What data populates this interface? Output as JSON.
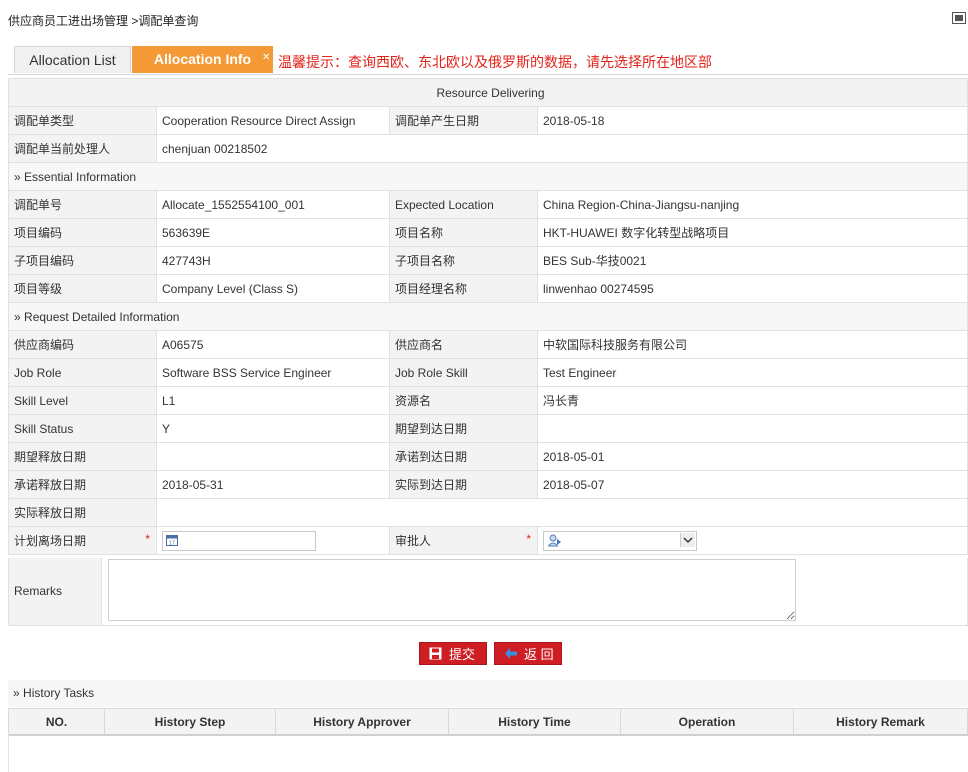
{
  "breadcrumb": "供应商员工进出场管理 >调配单查询",
  "tabs": {
    "list": "Allocation List",
    "info": "Allocation Info"
  },
  "hint": "温馨提示：查询西欧、东北欧以及俄罗斯的数据，请先选择所在地区部",
  "status_bar": "Resource Delivering",
  "header_rows": {
    "type_label": "调配单类型",
    "type_value": "Cooperation Resource Direct Assign",
    "date_label": "调配单产生日期",
    "date_value": "2018-05-18",
    "handler_label": "调配单当前处理人",
    "handler_value": "chenjuan 00218502"
  },
  "essential": {
    "title": "Essential Information",
    "no_label": "调配单号",
    "no_value": "Allocate_1552554100_001",
    "loc_label": "Expected Location",
    "loc_value": "China Region-China-Jiangsu-nanjing",
    "proj_code_label": "项目编码",
    "proj_code_value": "563639E",
    "proj_name_label": "项目名称",
    "proj_name_value": "HKT-HUAWEI 数字化转型战略项目",
    "sub_code_label": "子项目编码",
    "sub_code_value": "427743H",
    "sub_name_label": "子项目名称",
    "sub_name_value": "BES Sub-华技0021",
    "level_label": "项目等级",
    "level_value": "Company Level (Class S)",
    "pm_label": "项目经理名称",
    "pm_value": "linwenhao 00274595"
  },
  "request": {
    "title": "Request Detailed Information",
    "supplier_code_label": "供应商编码",
    "supplier_code_value": "A06575",
    "supplier_name_label": "供应商名",
    "supplier_name_value": "中软国际科技服务有限公司",
    "role_label": "Job Role",
    "role_value": "Software BSS Service Engineer",
    "role_skill_label": "Job Role Skill",
    "role_skill_value": "Test Engineer",
    "skill_level_label": "Skill Level",
    "skill_level_value": "L1",
    "resource_label": "资源名",
    "resource_value": "冯长青",
    "skill_status_label": "Skill Status",
    "skill_status_value": "Y",
    "expect_arrive_label": "期望到达日期",
    "expect_arrive_value": "",
    "expect_release_label": "期望释放日期",
    "expect_release_value": "",
    "promise_arrive_label": "承诺到达日期",
    "promise_arrive_value": "2018-05-01",
    "promise_release_label": "承诺释放日期",
    "promise_release_value": "2018-05-31",
    "actual_arrive_label": "实际到达日期",
    "actual_arrive_value": "2018-05-07",
    "actual_release_label": "实际释放日期",
    "actual_release_value": "",
    "plan_leave_label": "计划离场日期",
    "plan_leave_value": "",
    "approver_label": "审批人",
    "approver_value": "",
    "required_mark": "*"
  },
  "remarks": {
    "label": "Remarks",
    "value": ""
  },
  "buttons": {
    "submit": "提交",
    "back": "返 回"
  },
  "history": {
    "title": "History Tasks",
    "columns": [
      "NO.",
      "History Step",
      "History Approver",
      "History Time",
      "Operation",
      "History Remark"
    ]
  },
  "colors": {
    "accent_tab": "#f39a37",
    "button": "#cf1e23",
    "hint": "#e2231a"
  }
}
